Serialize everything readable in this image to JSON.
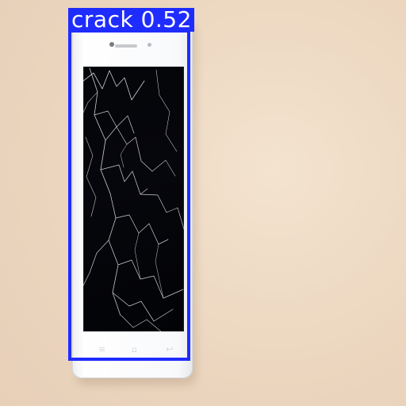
{
  "image": {
    "background_color": "#efdcc6",
    "subject": "smartphone-with-cracked-screen"
  },
  "detection": {
    "label": "crack 0.52",
    "color": "#1f2cff"
  },
  "phone": {
    "body_color": "#f8f9fb",
    "screen_color": "#040509",
    "icons": [
      "menu-icon",
      "home-icon",
      "back-icon"
    ]
  }
}
